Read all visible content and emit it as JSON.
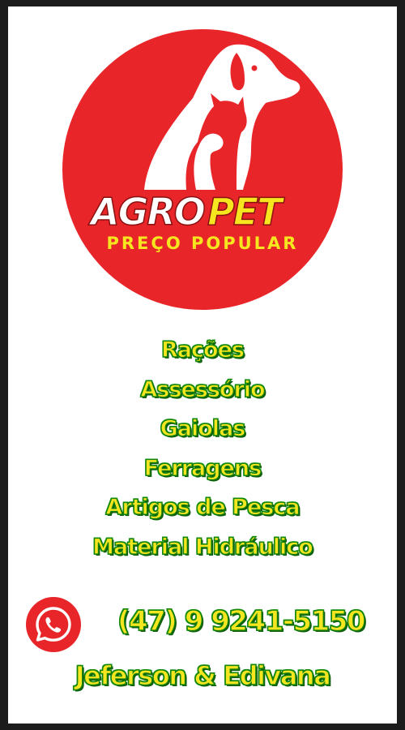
{
  "brand": {
    "name_part1": "AGRO",
    "name_part2": "PET",
    "tagline": "PREÇO POPULAR"
  },
  "services": [
    "Rações",
    "Assessório",
    "Gaiolas",
    "Ferragens",
    "Artigos de Pesca",
    "Material Hidráulico"
  ],
  "contact": {
    "phone": "(47) 9 9241-5150",
    "owners": "Jeferson & Edivana",
    "whatsapp_icon": "whatsapp-icon"
  },
  "colors": {
    "logo_red": "#e8262a",
    "text_yellow": "#f5e61f",
    "text_green": "#14820f",
    "frame_dark": "#1c1c1c"
  }
}
